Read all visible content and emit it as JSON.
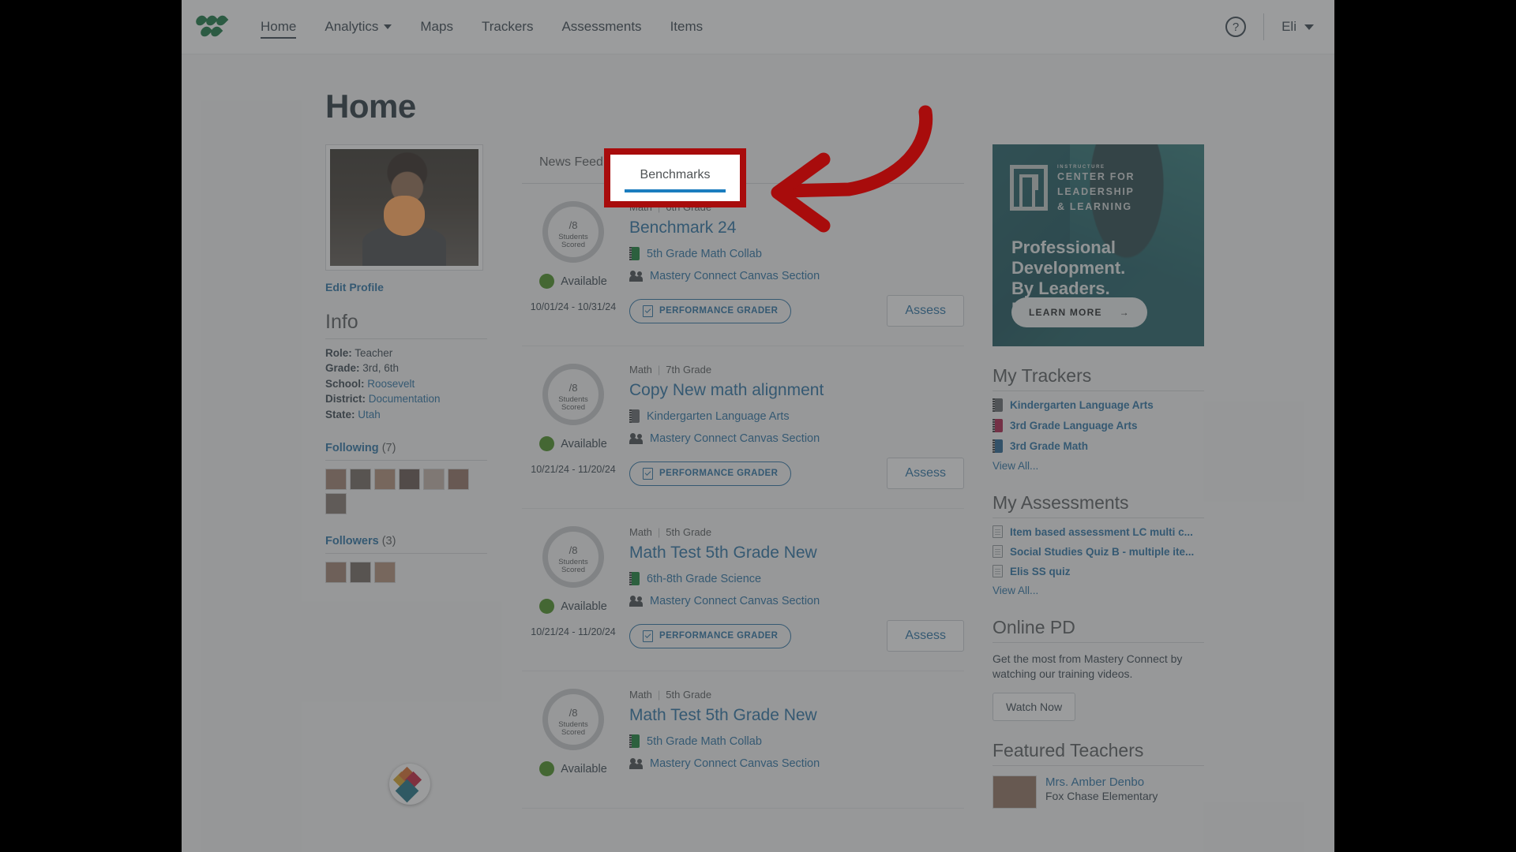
{
  "nav": {
    "logo_name": "mastery-connect-logo",
    "items": [
      {
        "label": "Home",
        "active": true,
        "has_caret": false
      },
      {
        "label": "Analytics",
        "active": false,
        "has_caret": true
      },
      {
        "label": "Maps",
        "active": false,
        "has_caret": false
      },
      {
        "label": "Trackers",
        "active": false,
        "has_caret": false
      },
      {
        "label": "Assessments",
        "active": false,
        "has_caret": false
      },
      {
        "label": "Items",
        "active": false,
        "has_caret": false
      }
    ],
    "help_icon": "help-circle-icon",
    "user_name": "Eli"
  },
  "page": {
    "title": "Home"
  },
  "profile": {
    "edit_profile_label": "Edit Profile",
    "info_heading": "Info",
    "info": [
      {
        "label": "Role:",
        "value": "Teacher",
        "is_link": false
      },
      {
        "label": "Grade:",
        "value": "3rd, 6th",
        "is_link": false
      },
      {
        "label": "School:",
        "value": "Roosevelt",
        "is_link": true
      },
      {
        "label": "District:",
        "value": "Documentation",
        "is_link": true
      },
      {
        "label": "State:",
        "value": "Utah",
        "is_link": true
      }
    ],
    "following_label": "Following",
    "following_count": "(7)",
    "following_thumbs": 7,
    "followers_label": "Followers",
    "followers_count": "(3)",
    "followers_thumbs": 3
  },
  "tabs": [
    {
      "label": "News Feed",
      "active": false
    },
    {
      "label": "Benchmarks",
      "active": true
    }
  ],
  "highlight": {
    "target_tab_label": "Benchmarks",
    "box_color": "#a80c0c",
    "arrow_color": "#a80c0c"
  },
  "benchmarks": [
    {
      "score": "0",
      "score_total": "/8",
      "score_label_line1": "Students",
      "score_label_line2": "Scored",
      "status": "Available",
      "status_color": "#3e8914",
      "date_range": "10/01/24 - 10/31/24",
      "subject": "Math",
      "grade": "6th Grade",
      "title": "Benchmark 24",
      "tracker": "5th Grade Math Collab",
      "tracker_color": "#0a7b2e",
      "section": "Mastery Connect Canvas Section",
      "grader_label": "PERFORMANCE GRADER",
      "assess_label": "Assess"
    },
    {
      "score": "0",
      "score_total": "/8",
      "score_label_line1": "Students",
      "score_label_line2": "Scored",
      "status": "Available",
      "status_color": "#3e8914",
      "date_range": "10/21/24 - 11/20/24",
      "subject": "Math",
      "grade": "7th Grade",
      "title": "Copy New math alignment",
      "tracker": "Kindergarten Language Arts",
      "tracker_color": "#5b6164",
      "section": "Mastery Connect Canvas Section",
      "grader_label": "PERFORMANCE GRADER",
      "assess_label": "Assess"
    },
    {
      "score": "0",
      "score_total": "/8",
      "score_label_line1": "Students",
      "score_label_line2": "Scored",
      "status": "Available",
      "status_color": "#3e8914",
      "date_range": "10/21/24 - 11/20/24",
      "subject": "Math",
      "grade": "5th Grade",
      "title": "Math Test 5th Grade New",
      "tracker": "6th-8th Grade Science",
      "tracker_color": "#0a7b2e",
      "section": "Mastery Connect Canvas Section",
      "grader_label": "PERFORMANCE GRADER",
      "assess_label": "Assess"
    },
    {
      "score": "0",
      "score_total": "/8",
      "score_label_line1": "Students",
      "score_label_line2": "Scored",
      "status": "Available",
      "status_color": "#3e8914",
      "date_range": "",
      "subject": "Math",
      "grade": "5th Grade",
      "title": "Math Test 5th Grade New",
      "tracker": "5th Grade Math Collab",
      "tracker_color": "#0a7b2e",
      "section": "Mastery Connect Canvas Section",
      "grader_label": "",
      "assess_label": ""
    }
  ],
  "ad": {
    "brand_kicker": "INSTRUCTURE",
    "brand_line1": "CENTER FOR",
    "brand_line2": "LEADERSHIP",
    "brand_line3": "& LEARNING",
    "headline": "Professional\nDevelopment.\nBy Leaders.\nFor Leaders.",
    "cta_label": "LEARN MORE"
  },
  "trackers": {
    "heading": "My Trackers",
    "items": [
      {
        "label": "Kindergarten Language Arts",
        "color": "#5b6164"
      },
      {
        "label": "3rd Grade Language Arts",
        "color": "#a8123f"
      },
      {
        "label": "3rd Grade Math",
        "color": "#1a5b8c"
      }
    ],
    "view_all": "View All..."
  },
  "assessments": {
    "heading": "My Assessments",
    "items": [
      {
        "label": "Item based assessment LC multi c..."
      },
      {
        "label": "Social Studies Quiz B - multiple ite..."
      },
      {
        "label": "Elis SS quiz"
      }
    ],
    "view_all": "View All..."
  },
  "online_pd": {
    "heading": "Online PD",
    "text": "Get the most from Mastery Connect by watching our training videos.",
    "button_label": "Watch Now"
  },
  "featured_teachers": {
    "heading": "Featured Teachers",
    "items": [
      {
        "name": "Mrs. Amber Denbo",
        "school": "Fox Chase Elementary"
      }
    ]
  },
  "pendo": {
    "name": "pendo-launcher"
  }
}
